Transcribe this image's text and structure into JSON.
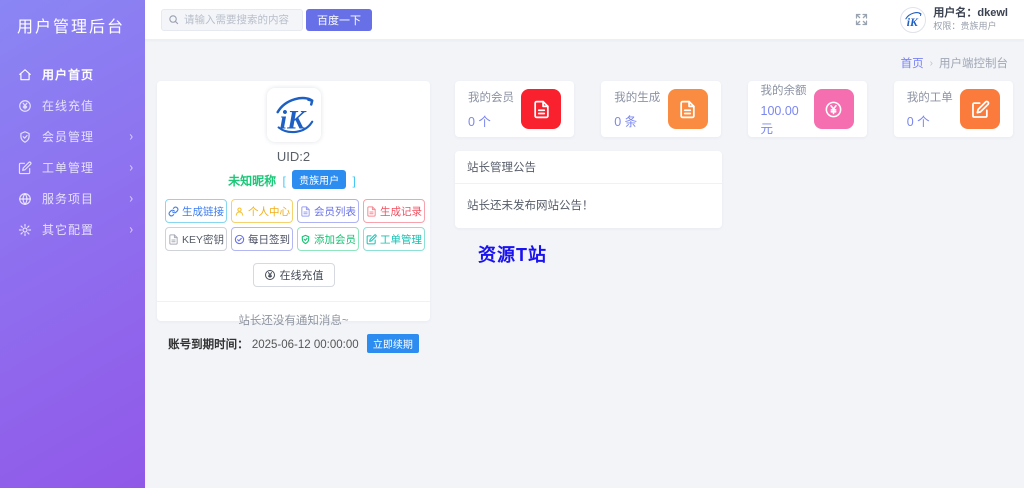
{
  "sidebar": {
    "title": "用户管理后台",
    "items": [
      {
        "label": "用户首页",
        "icon": "home-icon",
        "active": true,
        "has_submenu": false
      },
      {
        "label": "在线充值",
        "icon": "yen-circle-icon",
        "active": false,
        "has_submenu": false
      },
      {
        "label": "会员管理",
        "icon": "shield-check-icon",
        "active": false,
        "has_submenu": true
      },
      {
        "label": "工单管理",
        "icon": "document-edit-icon",
        "active": false,
        "has_submenu": true
      },
      {
        "label": "服务项目",
        "icon": "globe-icon",
        "active": false,
        "has_submenu": true
      },
      {
        "label": "其它配置",
        "icon": "gear-icon",
        "active": false,
        "has_submenu": true
      }
    ],
    "submenu_arrow": "›"
  },
  "topbar": {
    "search_placeholder": "请输入需要搜索的内容",
    "search_button_label": "百度一下",
    "username_label": "用户名：",
    "username_value": "dkewl",
    "role_label": "权限：",
    "role_value": "贵族用户"
  },
  "breadcrumb": {
    "home": "首页",
    "separator": "›",
    "current": "用户端控制台"
  },
  "profile": {
    "uid": "UID:2",
    "nickname": "未知昵称",
    "bracket_open": "[",
    "bracket_close": "]",
    "role_badge": "贵族用户",
    "actions": [
      {
        "label": "生成链接",
        "icon": "link-icon"
      },
      {
        "label": "个人中心",
        "icon": "person-icon"
      },
      {
        "label": "会员列表",
        "icon": "document-icon"
      },
      {
        "label": "生成记录",
        "icon": "document-icon"
      },
      {
        "label": "KEY密钥",
        "icon": "document-icon"
      },
      {
        "label": "每日签到",
        "icon": "check-circle-icon"
      },
      {
        "label": "添加会员",
        "icon": "shield-check-icon"
      },
      {
        "label": "工单管理",
        "icon": "document-edit-icon"
      }
    ],
    "recharge_label": "在线充值",
    "notice": "站长还没有通知消息~",
    "expire_label": "账号到期时间：",
    "expire_value": "2025-06-12 00:00:00",
    "renew_label": "立即续期"
  },
  "stats": [
    {
      "label": "我的会员",
      "value": "0 个",
      "icon": "document-icon",
      "color": "#f8212d"
    },
    {
      "label": "我的生成",
      "value": "0 条",
      "icon": "document-icon",
      "color": "#fa8c42"
    },
    {
      "label": "我的余额",
      "value": "100.00 元",
      "icon": "yen-circle-icon",
      "color": "#f56eb0"
    },
    {
      "label": "我的工单",
      "value": "0 个",
      "icon": "document-edit-icon",
      "color": "#fa7b3c"
    }
  ],
  "announcement": {
    "title": "站长管理公告",
    "body": "站长还未发布网站公告！"
  },
  "watermark": {
    "text": "资源T站",
    "color": "#1a13ef"
  },
  "colors": {
    "accent_indigo": "#6770e6",
    "badge_blue": "#2d8cf0",
    "stat_value_purple": "#7b87f0",
    "sidebar_gradient_top": "#8a86f4",
    "sidebar_gradient_bottom": "#9158e8",
    "nickname_green": "#1dc779",
    "background": "#f2f4f8"
  }
}
